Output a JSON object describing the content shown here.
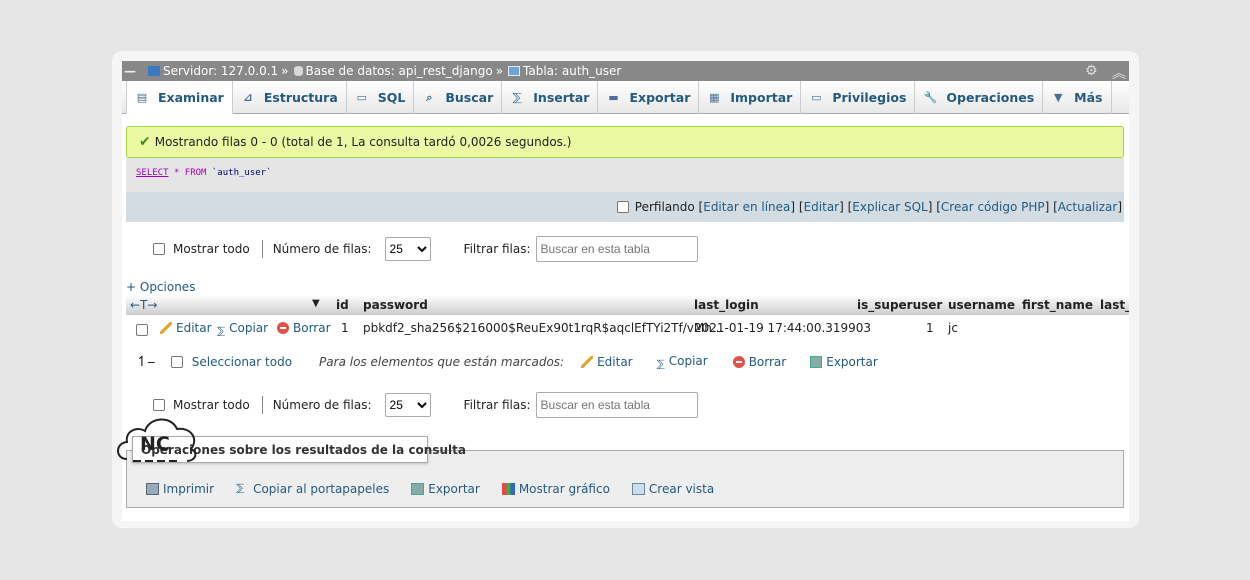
{
  "breadcrumb": {
    "server": "Servidor: 127.0.0.1",
    "database": "Base de datos: api_rest_django",
    "table": "Tabla: auth_user",
    "separator": "»"
  },
  "tabs": [
    {
      "label": "Examinar",
      "icon": "browse-icon"
    },
    {
      "label": "Estructura",
      "icon": "structure-icon"
    },
    {
      "label": "SQL",
      "icon": "sql-icon"
    },
    {
      "label": "Buscar",
      "icon": "search-icon"
    },
    {
      "label": "Insertar",
      "icon": "insert-icon"
    },
    {
      "label": "Exportar",
      "icon": "export-icon"
    },
    {
      "label": "Importar",
      "icon": "import-icon"
    },
    {
      "label": "Privilegios",
      "icon": "privileges-icon"
    },
    {
      "label": "Operaciones",
      "icon": "wrench-icon"
    },
    {
      "label": "Más",
      "icon": "triangle-down-icon"
    }
  ],
  "message": "Mostrando filas 0 - 0 (total de 1, La consulta tardó 0,0026 segundos.)",
  "sql": {
    "select": "SELECT",
    "star": "*",
    "from": "FROM",
    "table": "`auth_user`"
  },
  "sqlbar": {
    "profiling": "Perfilando",
    "edit_inline": "Editar en línea",
    "edit": "Editar",
    "explain": "Explicar SQL",
    "php": "Crear código PHP",
    "refresh": "Actualizar"
  },
  "nav": {
    "show_all": "Mostrar todo",
    "rows_label": "Número de filas:",
    "rows_value": "25",
    "filter_label": "Filtrar filas:",
    "filter_placeholder": "Buscar en esta tabla"
  },
  "options_link": "+ Opciones",
  "table": {
    "arrows": "←T→",
    "headers": [
      "id",
      "password",
      "last_login",
      "is_superuser",
      "username",
      "first_name",
      "last_"
    ],
    "row": {
      "edit": "Editar",
      "copy": "Copiar",
      "delete": "Borrar",
      "id": "1",
      "password": "pbkdf2_sha256$216000$ReuEx90t1rqR$aqclEfTYi2Tf/vMh...",
      "last_login": "2021-01-19 17:44:00.319903",
      "is_superuser": "1",
      "username": "jc"
    }
  },
  "bulk": {
    "select_all": "Seleccionar todo",
    "for_marked": "Para los elementos que están marcados:",
    "edit": "Editar",
    "copy": "Copiar",
    "delete": "Borrar",
    "export": "Exportar"
  },
  "query_ops": {
    "title": "Operaciones sobre los resultados de la consulta",
    "items": [
      "Imprimir",
      "Copiar al portapapeles",
      "Exportar",
      "Mostrar gráfico",
      "Crear vista"
    ]
  },
  "watermark": "NC",
  "colors": {
    "link": "#235a81",
    "success_bg": "#ebf8a4",
    "topbar": "#888888"
  }
}
